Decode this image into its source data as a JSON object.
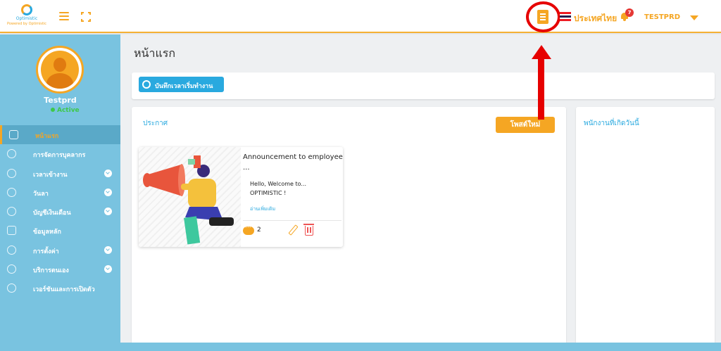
{
  "header": {
    "logo_name": "Optimistic",
    "logo_tagline": "Powered by Optimistic",
    "country_label": "ประเทศไทย",
    "notification_count": "7",
    "username": "TESTPRD"
  },
  "profile": {
    "name": "Testprd",
    "status": "Active"
  },
  "sidebar": {
    "items": [
      {
        "label": "หน้าแรก",
        "active": true,
        "has_submenu": false
      },
      {
        "label": "การจัดการบุคลากร",
        "active": false,
        "has_submenu": false
      },
      {
        "label": "เวลาเข้างาน",
        "active": false,
        "has_submenu": true
      },
      {
        "label": "วันลา",
        "active": false,
        "has_submenu": true
      },
      {
        "label": "บัญชีเงินเดือน",
        "active": false,
        "has_submenu": true
      },
      {
        "label": "ข้อมูลหลัก",
        "active": false,
        "has_submenu": false
      },
      {
        "label": "การตั้งค่า",
        "active": false,
        "has_submenu": true
      },
      {
        "label": "บริการตนเอง",
        "active": false,
        "has_submenu": true
      },
      {
        "label": "เวอร์ชันและการเปิดตัว",
        "active": false,
        "has_submenu": false
      }
    ]
  },
  "main": {
    "page_title": "หน้าแรก",
    "clockin_label": "บันทึกเวลาเริ่มทำงาน",
    "announcements": {
      "title": "ประกาศ",
      "new_post_label": "โพสต์ใหม่",
      "posts": [
        {
          "title": "Announcement to employee",
          "title_cont": "...",
          "body": "Hello, Welcome to... OPTIMISTIC !",
          "read_more": "อ่านเพิ่มเติม",
          "comment_count": "2"
        }
      ]
    },
    "birthdays": {
      "title": "พนักงานที่เกิดวันนี้"
    }
  },
  "colors": {
    "accent": "#f5a623",
    "brand_blue": "#29a9df",
    "sidebar_bg": "#79c3e0",
    "annotation_red": "#e60000"
  }
}
